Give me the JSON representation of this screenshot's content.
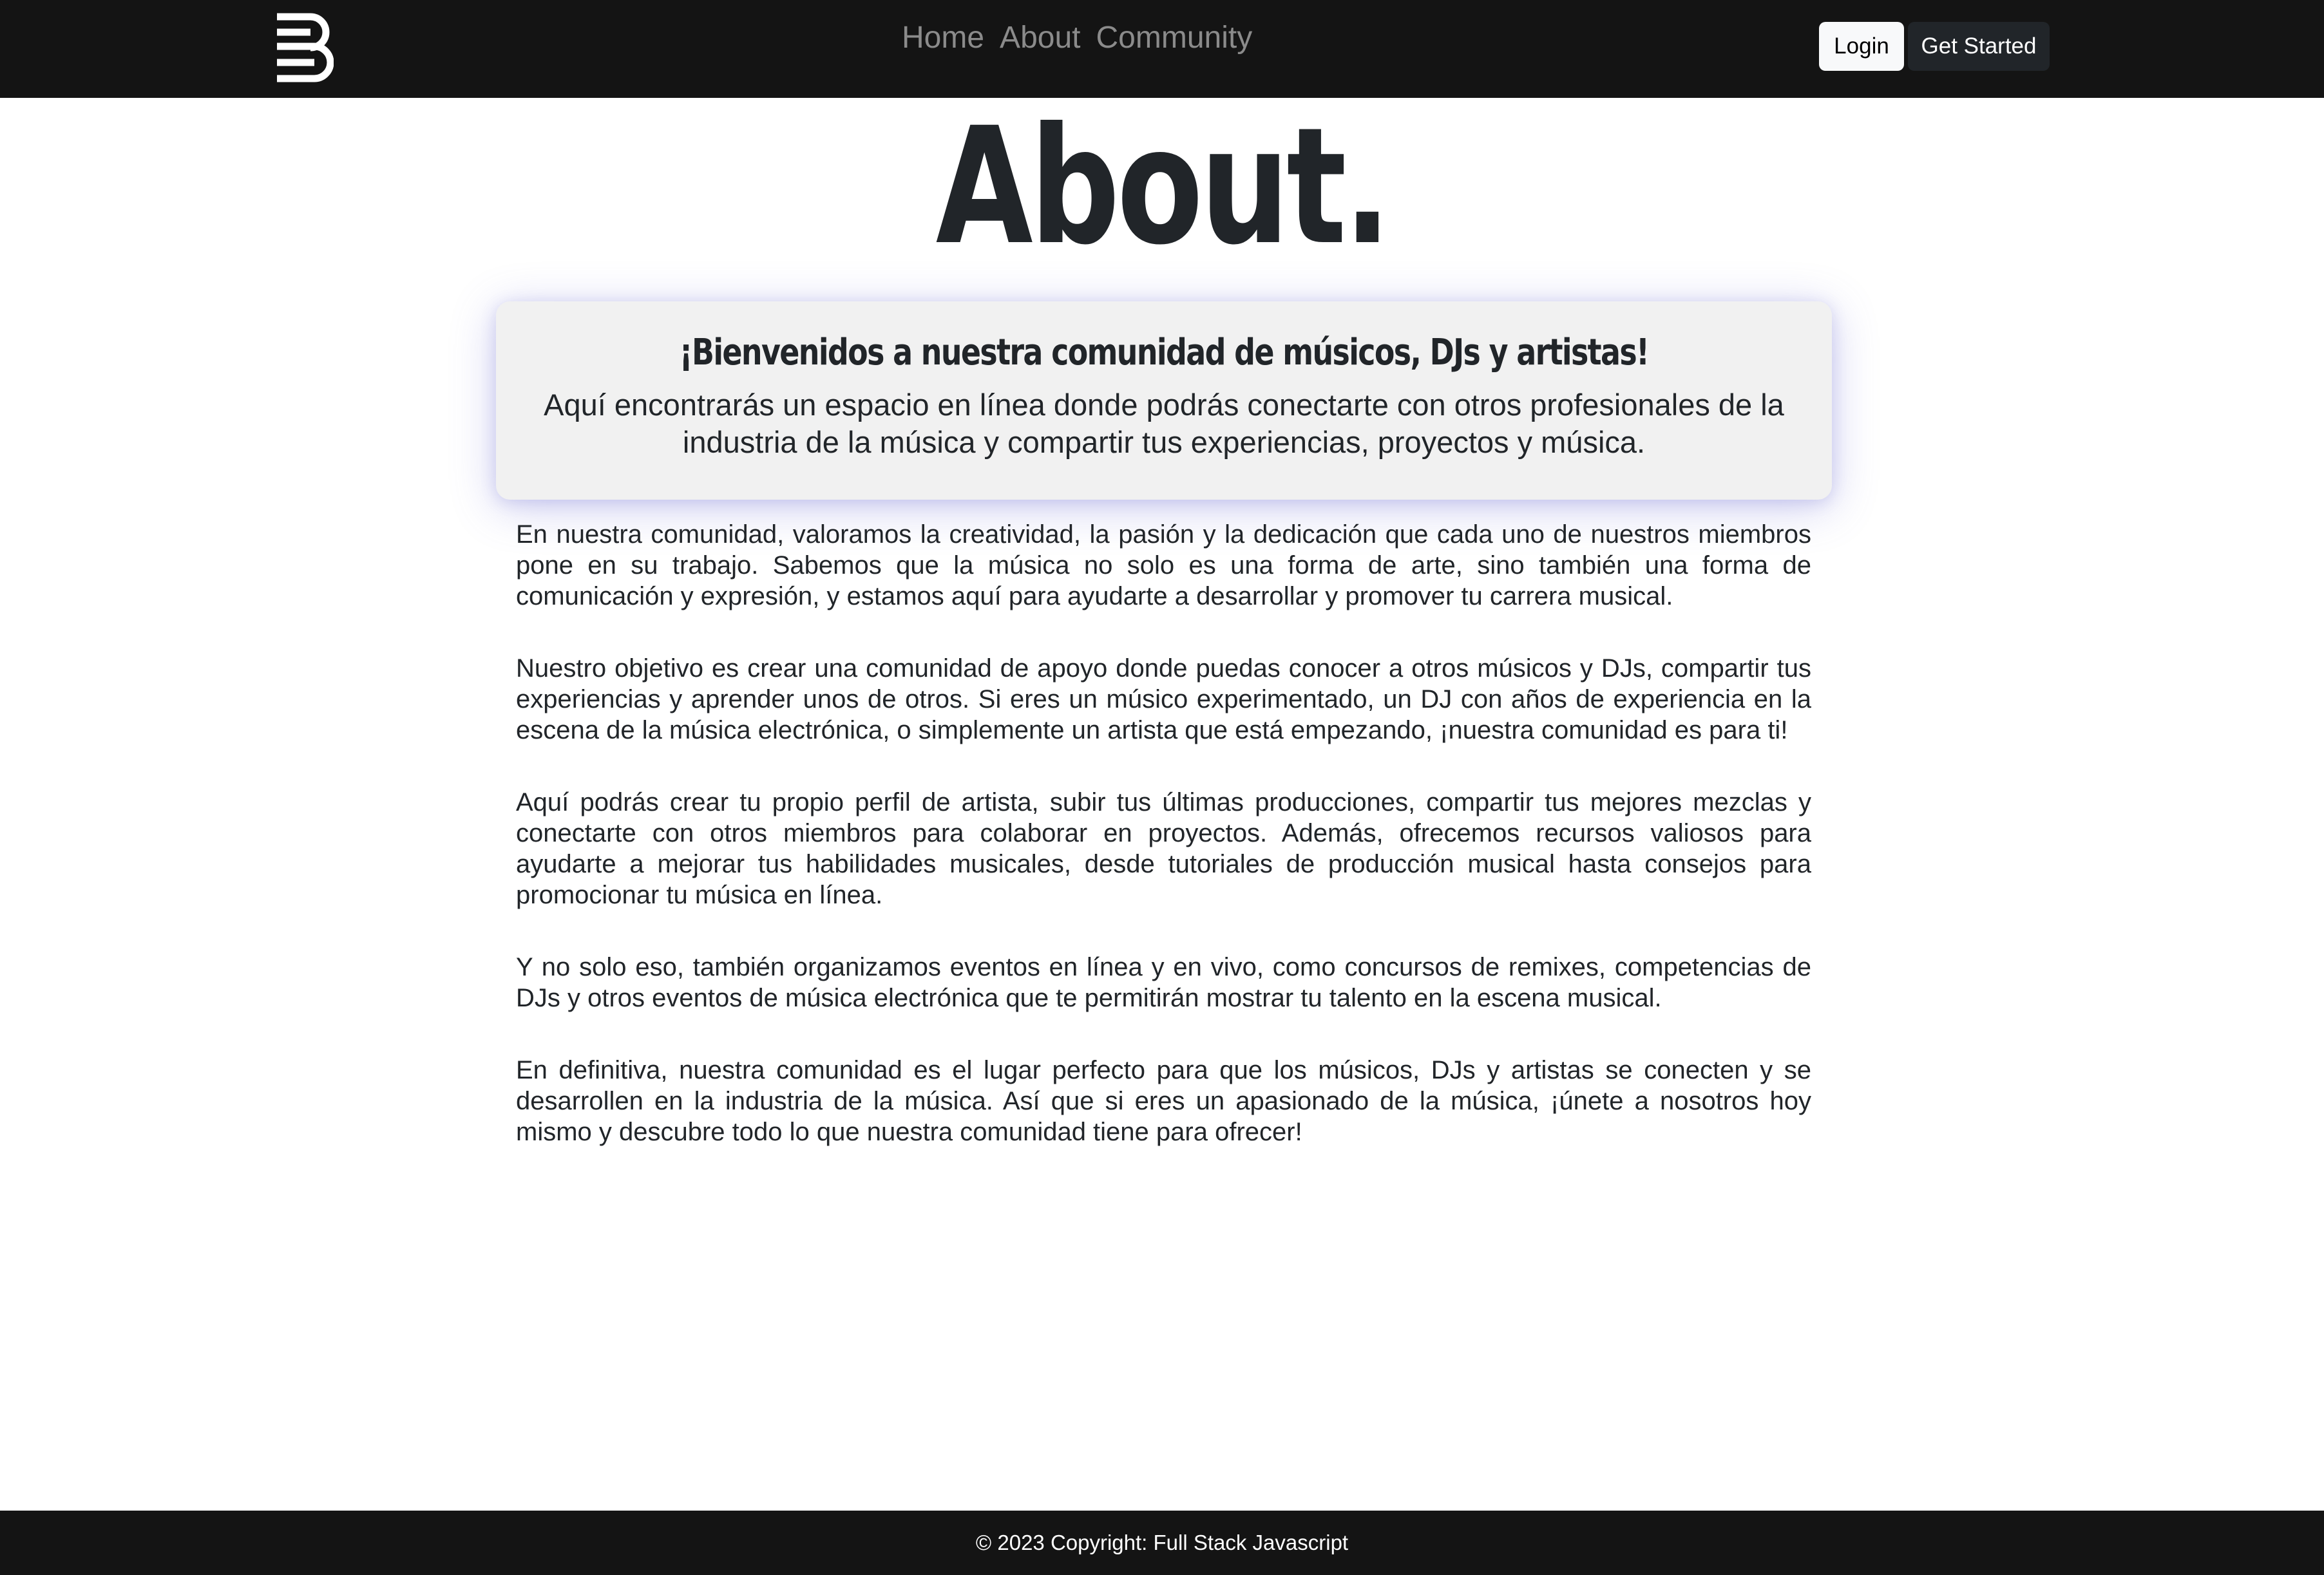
{
  "navbar": {
    "logo_icon": "b-logo-icon",
    "links": [
      "Home",
      "About",
      "Community"
    ],
    "login_label": "Login",
    "get_started_label": "Get Started"
  },
  "page": {
    "title": "About."
  },
  "welcome": {
    "title": "¡Bienvenidos a nuestra comunidad de músicos, DJs y artistas!",
    "text": "Aquí encontrarás un espacio en línea donde podrás conectarte con otros profesionales de la industria de la música y compartir tus experiencias, proyectos y música."
  },
  "paragraphs": [
    "En nuestra comunidad, valoramos la creatividad, la pasión y la dedicación que cada uno de nuestros miembros pone en su trabajo. Sabemos que la música no solo es una forma de arte, sino también una forma de comunicación y expresión, y estamos aquí para ayudarte a desarrollar y promover tu carrera musical.",
    "Nuestro objetivo es crear una comunidad de apoyo donde puedas conocer a otros músicos y DJs, compartir tus experiencias y aprender unos de otros. Si eres un músico experimentado, un DJ con años de experiencia en la escena de la música electrónica, o simplemente un artista que está empezando, ¡nuestra comunidad es para ti!",
    "Aquí podrás crear tu propio perfil de artista, subir tus últimas producciones, compartir tus mejores mezclas y conectarte con otros miembros para colaborar en proyectos. Además, ofrecemos recursos valiosos para ayudarte a mejorar tus habilidades musicales, desde tutoriales de producción musical hasta consejos para promocionar tu música en línea.",
    "Y no solo eso, también organizamos eventos en línea y en vivo, como concursos de remixes, competencias de DJs y otros eventos de música electrónica que te permitirán mostrar tu talento en la escena musical.",
    "En definitiva, nuestra comunidad es el lugar perfecto para que los músicos, DJs y artistas se conecten y se desarrollen en la industria de la música. Así que si eres un apasionado de la música, ¡únete a nosotros hoy mismo y descubre todo lo que nuestra comunidad tiene para ofrecer!"
  ],
  "footer": {
    "text": "© 2023 Copyright: Full Stack Javascript"
  },
  "colors": {
    "navbar_bg": "#141414",
    "card_bg": "#f1f1f1",
    "text": "#212529",
    "nav_link": "#8b8b8b"
  }
}
